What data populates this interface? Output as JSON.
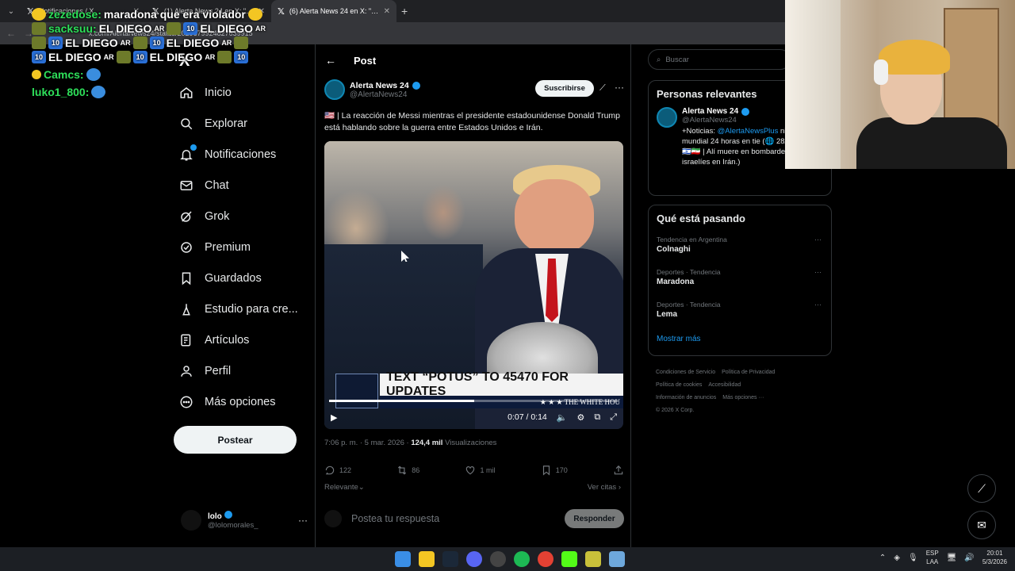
{
  "browser": {
    "tabs": [
      {
        "title": "Notificaciones / X",
        "active": false
      },
      {
        "title": "(1) Alerta News 24 en X: \"us | M",
        "active": false
      },
      {
        "title": "(6) Alerta News 24 en X: \"us | La",
        "active": true
      }
    ],
    "url": "x.com/AlertaNews24/status/2029679924827639915"
  },
  "chat": {
    "lines": [
      {
        "user": "zezedose:",
        "msg": "maradona que era violador"
      },
      {
        "user": "sacksuu:",
        "msg": "EL DIEGO"
      },
      {
        "user": "Camcs:",
        "msg": ""
      },
      {
        "user": "luko1_800:",
        "msg": ""
      }
    ],
    "spam_text": "EL DIEGO",
    "spam_suffix": "AR"
  },
  "nav": {
    "logo": "X",
    "items": [
      {
        "label": "Inicio",
        "icon": "home-icon"
      },
      {
        "label": "Explorar",
        "icon": "search-icon"
      },
      {
        "label": "Notificaciones",
        "icon": "bell-icon"
      },
      {
        "label": "Chat",
        "icon": "mail-icon"
      },
      {
        "label": "Grok",
        "icon": "grok-icon"
      },
      {
        "label": "Premium",
        "icon": "verified-badge-icon"
      },
      {
        "label": "Guardados",
        "icon": "bookmark-icon"
      },
      {
        "label": "Estudio para cre...",
        "icon": "creator-studio-icon"
      },
      {
        "label": "Artículos",
        "icon": "article-icon"
      },
      {
        "label": "Perfil",
        "icon": "profile-icon"
      },
      {
        "label": "Más opciones",
        "icon": "more-circle-icon"
      }
    ],
    "post_button": "Postear",
    "profile": {
      "name": "lolo",
      "handle": "@lolomorales_"
    }
  },
  "post": {
    "header": "Post",
    "author_name": "Alerta News 24",
    "author_handle": "@AlertaNews24",
    "subscribe": "Suscribirse",
    "text": "🇺🇸 | La reacción de Messi mientras el presidente estadounidense Donald Trump está hablando sobre la guerra entre Estados Unidos e Irán.",
    "video": {
      "chyron": "TEXT “POTUS” TO 45470 FOR UPDATES",
      "chyron_sub": "★ ★ ★  THE WHITE HOU",
      "time": "0:07 / 0:14",
      "progress": 0.5
    },
    "timestamp": "7:06 p. m. · 5 mar. 2026 · ",
    "views_count": "124,4 mil",
    "views_label": " Visualizaciones",
    "stats": {
      "replies": "122",
      "reposts": "86",
      "likes": "1 mil",
      "bookmarks": "170"
    },
    "relevant": "Relevante",
    "quotes": "Ver citas",
    "reply_placeholder": "Postea tu respuesta",
    "reply_button": "Responder"
  },
  "sidebar": {
    "search_placeholder": "Buscar",
    "relevant_title": "Personas relevantes",
    "person": {
      "name": "Alerta News 24",
      "handle": "@AlertaNews24",
      "bio_prefix": "+Noticias: ",
      "bio_link": "@AlertaNewsPlus",
      "bio_rest": " nivel mundial 24 horas en tie (🌐 28/02/26: 🇺🇸🇮🇱🇮🇷 | Alí muere en bombardeos israelíes en Irán.)"
    },
    "trends_title": "Qué está pasando",
    "trends": [
      {
        "meta": "Tendencia en Argentina",
        "name": "Colnaghi"
      },
      {
        "meta": "Deportes · Tendencia",
        "name": "Maradona"
      },
      {
        "meta": "Deportes · Tendencia",
        "name": "Lema"
      }
    ],
    "show_more": "Mostrar más",
    "footer": [
      "Condiciones de Servicio",
      "Política de Privacidad",
      "Política de cookies",
      "Accesibilidad",
      "Información de anuncios",
      "Más opciones ···",
      "© 2026 X Corp."
    ]
  },
  "taskbar": {
    "lang": [
      "ESP",
      "LAA"
    ],
    "time": "20:01",
    "date": "5/3/2026"
  }
}
